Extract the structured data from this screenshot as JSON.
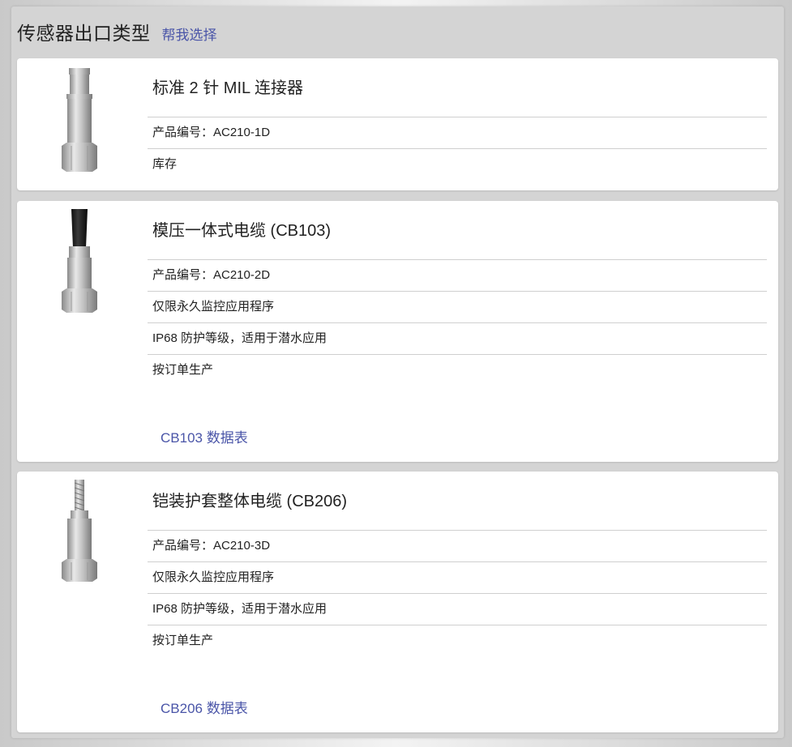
{
  "header": {
    "title": "传感器出口类型",
    "help_link": "帮我选择"
  },
  "products": [
    {
      "title": "标准 2 针 MIL 连接器",
      "rows": [
        "产品编号：AC210-1D",
        "库存"
      ],
      "image_icon": "sensor-mil-connector"
    },
    {
      "title": "模压一体式电缆 (CB103)",
      "rows": [
        "产品编号：AC210-2D",
        "仅限永久监控应用程序",
        "IP68 防护等级，适用于潜水应用",
        "按订单生产"
      ],
      "datasheet": "CB103 数据表",
      "image_icon": "sensor-molded-cable"
    },
    {
      "title": "铠装护套整体电缆 (CB206)",
      "rows": [
        "产品编号：AC210-3D",
        "仅限永久监控应用程序",
        "IP68 防护等级，适用于潜水应用",
        "按订单生产"
      ],
      "datasheet": "CB206 数据表",
      "image_icon": "sensor-armored-cable"
    }
  ],
  "colors": {
    "link": "#4a55a8",
    "panel": "#d4d4d4",
    "card": "#ffffff",
    "divider": "#cfcfcf"
  }
}
